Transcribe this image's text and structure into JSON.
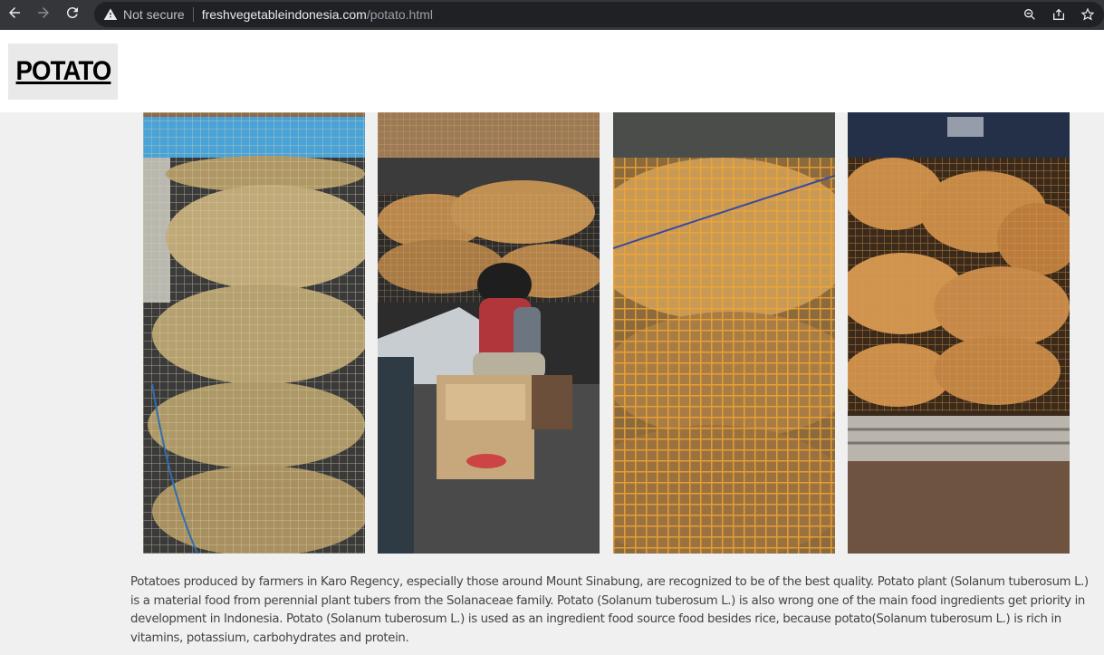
{
  "browser": {
    "security_label": "Not secure",
    "url_host": "freshvegetableindonesia.com",
    "url_path": "/potato.html",
    "icons": [
      "back-icon",
      "forward-icon",
      "reload-icon",
      "warning-icon",
      "zoom-icon",
      "share-icon",
      "star-icon"
    ]
  },
  "page": {
    "title": "POTATO",
    "description": "Potatoes produced by farmers in Karo Regency, especially those around Mount Sinabung, are recognized to be of the best quality. Potato plant (Solanum tuberosum L.) is a material food from perennial plant tubers from the Solanaceae family. Potato (Solanum tuberosum L.) is also wrong one of the main food ingredients get priority in development in Indonesia. Potato (Solanum tuberosum L.) is used as an ingredient food source food besides rice, because potato(Solanum tuberosum L.) is rich in vitamins, potassium, carbohydrates and protein."
  },
  "colors": {
    "chrome": "#35363a",
    "omnibox": "#202124",
    "page_bg": "#f0f0f0",
    "net_orange": "#e8a23a"
  }
}
